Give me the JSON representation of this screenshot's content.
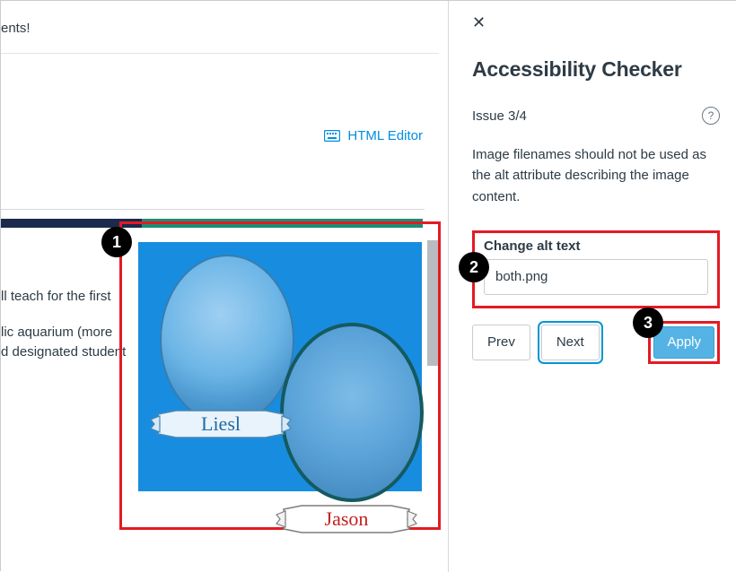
{
  "main": {
    "top_text_fragment": "ents!",
    "html_editor_label": "HTML Editor",
    "paragraph1": "ll teach for the first",
    "paragraph2a": "lic aquarium (more",
    "paragraph2b": "d designated student",
    "ribbon_liesl": "Liesl",
    "ribbon_jason": "Jason"
  },
  "sidebar": {
    "title": "Accessibility Checker",
    "issue_label": "Issue 3/4",
    "issue_description": "Image filenames should not be used as the alt attribute describing the image content.",
    "field_label": "Change alt text",
    "alt_value": "both.png",
    "prev_label": "Prev",
    "next_label": "Next",
    "apply_label": "Apply"
  },
  "badges": {
    "one": "1",
    "two": "2",
    "three": "3"
  }
}
